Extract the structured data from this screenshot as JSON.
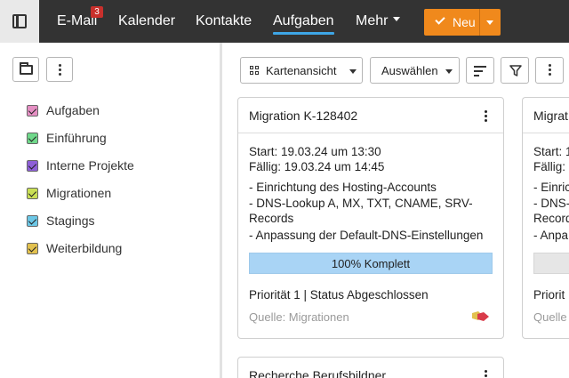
{
  "nav": {
    "items": [
      {
        "label": "E-Mail",
        "badge": "3"
      },
      {
        "label": "Kalender"
      },
      {
        "label": "Kontakte"
      },
      {
        "label": "Aufgaben",
        "active": true
      },
      {
        "label": "Mehr"
      }
    ],
    "new_label": "Neu",
    "accent": "#f0891c",
    "active_underline": "#3ea6e6"
  },
  "sidebar": {
    "folders": [
      {
        "label": "Aufgaben",
        "color": "#e58fc3"
      },
      {
        "label": "Einführung",
        "color": "#6fd88a"
      },
      {
        "label": "Interne Projekte",
        "color": "#8e5fd8"
      },
      {
        "label": "Migrationen",
        "color": "#c9df55"
      },
      {
        "label": "Stagings",
        "color": "#6cc7e6"
      },
      {
        "label": "Weiterbildung",
        "color": "#e2c14e"
      }
    ]
  },
  "toolbar": {
    "view_label": "Kartenansicht",
    "select_label": "Auswählen"
  },
  "cards": [
    {
      "title": "Migration K-128402",
      "start": "Start: 19.03.24 um 13:30",
      "due": "Fällig: 19.03.24 um 14:45",
      "lines": [
        "- Einrichtung des Hosting-Accounts",
        "- DNS-Lookup A, MX, TXT, CNAME, SRV-",
        "Records",
        "- Anpassung der Default-DNS-Einstellungen"
      ],
      "progress_label": "100% Komplett",
      "progress": 1.0,
      "meta": "Priorität 1  |  Status Abgeschlossen",
      "source": "Quelle: Migrationen"
    },
    {
      "title": "Migrat",
      "start": "Start: 1",
      "due": "Fällig:",
      "lines": [
        "- Einric",
        "- DNS-",
        "Record",
        "- Anpa"
      ],
      "meta": "Priorit",
      "source": "Quelle"
    },
    {
      "title": "Recherche Berufsbildner"
    }
  ]
}
